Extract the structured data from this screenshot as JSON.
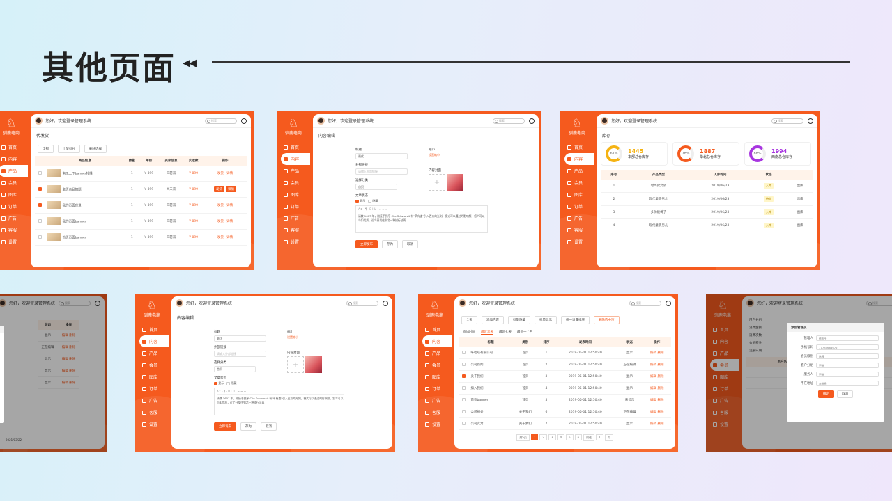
{
  "page": {
    "title": "其他页面",
    "deco": "◂◂"
  },
  "shared": {
    "greeting": "您好，欢迎登录管理系统",
    "search_placeholder": "搜索",
    "logo_text": "驯鹿电商",
    "nav": [
      "首页",
      "内容",
      "产品",
      "会员",
      "图库",
      "订单",
      "广告",
      "客服",
      "设置"
    ]
  },
  "card1": {
    "breadcrumb": "代发货",
    "buttons": [
      "全部",
      "上架批片",
      "删除选择"
    ],
    "columns": [
      "商品信息",
      "数量",
      "单价",
      "买家信息",
      "实收款",
      "操作"
    ],
    "rows": [
      {
        "name": "南瓜上下banner轮播",
        "qty": "1",
        "price": "¥ 899",
        "buyer": "天若海",
        "paid": "¥ 899",
        "checked": false
      },
      {
        "name": "主页商品摘题",
        "qty": "1",
        "price": "¥ 899",
        "buyer": "大未来",
        "paid": "¥ 899",
        "checked": true
      },
      {
        "name": "我的页面背景",
        "qty": "1",
        "price": "¥ 899",
        "buyer": "天若海",
        "paid": "¥ 899",
        "checked": true
      },
      {
        "name": "我的页面banner",
        "qty": "1",
        "price": "¥ 899",
        "buyer": "天若海",
        "paid": "¥ 899",
        "checked": false
      },
      {
        "name": "首页页面banner",
        "qty": "1",
        "price": "¥ 899",
        "buyer": "天若海",
        "paid": "¥ 899",
        "checked": false
      }
    ],
    "actions": [
      "发货",
      "详情"
    ]
  },
  "card2": {
    "breadcrumb": "内容编辑",
    "title_label": "标题",
    "title_value": "最优",
    "link_label": "外部链接",
    "link_placeholder": "请输入外部链接",
    "cat_label": "选择分类",
    "cat_value": "首页",
    "cover_label": "缩小",
    "cover_add": "设置缩小",
    "img_label": "内容封面",
    "status_label": "文章状态",
    "status_opts": [
      "显示",
      "隐藏"
    ],
    "editor_text": "请教 1607 年，刚接手到序 Clio Schwarzit 有\"草有道\"引入西方的光刻。模式可以通过的影响频，您个可以与如优质，近个开发住到北一种描行法再",
    "buttons": [
      "立即发布",
      "存为",
      "取消"
    ]
  },
  "card3": {
    "breadcrumb": "库存",
    "stats": [
      {
        "pct": "67%",
        "value": "1445",
        "label": "本部总仓库存",
        "color": "#f5b312"
      },
      {
        "pct": "78%",
        "value": "1887",
        "label": "华北总仓库存",
        "color": "#f55a1e"
      },
      {
        "pct": "88%",
        "value": "1994",
        "label": "西南总仓库存",
        "color": "#a836e0"
      }
    ],
    "columns": [
      "序号",
      "产品类型",
      "入库时间",
      "状态",
      ""
    ],
    "rows": [
      {
        "no": "1",
        "type": "时尚款女装",
        "date": "2019/06/23",
        "status": "入库",
        "op": "出库"
      },
      {
        "no": "2",
        "type": "现代童装男儿",
        "date": "2019/06/23",
        "status": "待审",
        "op": "出库"
      },
      {
        "no": "3",
        "type": "多功能椅子",
        "date": "2019/06/23",
        "status": "入库",
        "op": "出库"
      },
      {
        "no": "4",
        "type": "现代童装男儿",
        "date": "2019/06/23",
        "status": "入库",
        "op": "出库"
      }
    ]
  },
  "card5": {
    "breadcrumb": "内容编辑"
  },
  "card6": {
    "breadcrumb": "内容管理",
    "toolbar": [
      "全部",
      "添加内容",
      "批量隐藏",
      "批量显示",
      "统一设置排序",
      "删除选中项"
    ],
    "filters": [
      "添加时间",
      "最近三天",
      "最近七天",
      "最近一个月"
    ],
    "columns": [
      "标题",
      "类别",
      "排序",
      "发表时间",
      "状态",
      "操作"
    ],
    "rows": [
      {
        "title": "咔嗒嗒有限公司",
        "cat": "首页",
        "sort": "1",
        "time": "2019-05-01 12:50:40",
        "status": "显示",
        "checked": false
      },
      {
        "title": "公司新闻",
        "cat": "首页",
        "sort": "2",
        "time": "2019-05-01 12:50:40",
        "status": "正在编辑",
        "checked": false
      },
      {
        "title": "关于我们",
        "cat": "首页",
        "sort": "3",
        "time": "2019-05-01 12:50:40",
        "status": "显示",
        "checked": true
      },
      {
        "title": "加入我们",
        "cat": "首页",
        "sort": "4",
        "time": "2019-05-01 12:50:40",
        "status": "显示",
        "checked": false
      },
      {
        "title": "首页banner",
        "cat": "首页",
        "sort": "5",
        "time": "2019-05-01 12:50:40",
        "status": "未显示",
        "checked": false
      },
      {
        "title": "公司相关",
        "cat": "关于我们",
        "sort": "6",
        "time": "2019-05-01 12:50:40",
        "status": "正在编辑",
        "checked": false
      },
      {
        "title": "公司实力",
        "cat": "关于我们",
        "sort": "7",
        "time": "2019-05-01 12:50:40",
        "status": "显示",
        "checked": false
      }
    ],
    "row_actions": [
      "编辑",
      "删除"
    ],
    "pager": [
      "共5页",
      "1",
      "2",
      "3",
      "4",
      "5",
      "6",
      "前往",
      "1",
      "页"
    ]
  },
  "card4": {
    "fields": [
      "",
      "",
      "",
      "",
      "",
      "",
      ""
    ],
    "columns": [
      "状态",
      "操作"
    ],
    "rows": [
      "显示",
      "正在编辑",
      "显示",
      "显示",
      "显示"
    ],
    "actions": [
      "编辑",
      "删除"
    ],
    "footer": "2021/03/22"
  },
  "card7": {
    "breadcrumb": "会员管理",
    "modal_title": "添加管理员",
    "fields": [
      {
        "label": "管理人",
        "value": "徐国平"
      },
      {
        "label": "手机号码",
        "value": "17735688672"
      },
      {
        "label": "会员级别",
        "value": "选择"
      },
      {
        "label": "客户分组",
        "value": "不选"
      },
      {
        "label": "服务人",
        "value": "不选"
      },
      {
        "label": "用在地址",
        "value": "未选择"
      }
    ],
    "buttons": [
      "确定",
      "取消"
    ],
    "bg_labels": [
      "用户分组:",
      "消费金额:",
      "消费次数:",
      "会员积分:",
      "注册日期:"
    ],
    "bg_cols": [
      "用户名",
      "会员级别"
    ]
  }
}
